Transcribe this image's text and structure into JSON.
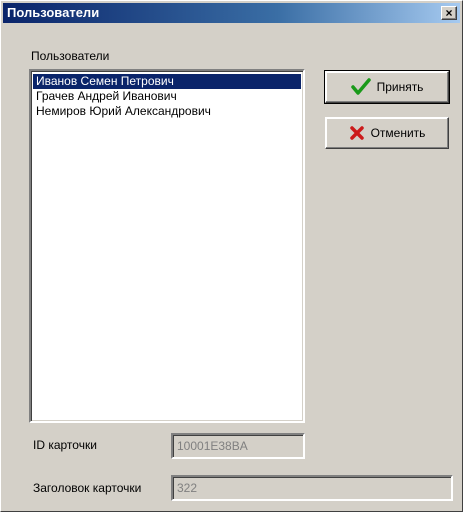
{
  "window": {
    "title": "Пользователи",
    "close_glyph": "×"
  },
  "users_group": {
    "label": "Пользователи",
    "items": [
      {
        "name": "Иванов Семен Петрович",
        "selected": true
      },
      {
        "name": "Грачев Андрей Иванович",
        "selected": false
      },
      {
        "name": "Немиров Юрий Александрович",
        "selected": false
      }
    ]
  },
  "buttons": {
    "accept_label": "Принять",
    "cancel_label": "Отменить",
    "accept_icon": "checkmark-icon",
    "cancel_icon": "cross-icon",
    "accept_color": "#1a9a1a",
    "cancel_color": "#cc1a1a"
  },
  "fields": {
    "card_id_label": "ID карточки",
    "card_id_value": "10001E38BA",
    "card_title_label": "Заголовок карточки",
    "card_title_value": "322"
  }
}
